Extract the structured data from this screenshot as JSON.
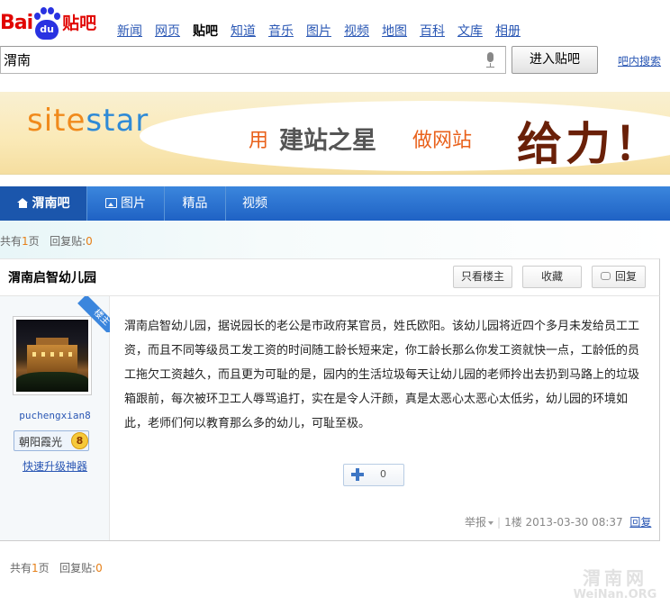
{
  "header": {
    "logo": {
      "bai": "Bai",
      "du": "du",
      "tieba": "贴吧"
    },
    "nav": [
      "新闻",
      "网页",
      "贴吧",
      "知道",
      "音乐",
      "图片",
      "视频",
      "地图",
      "百科",
      "文库",
      "相册"
    ],
    "nav_current": "贴吧"
  },
  "search": {
    "value": "渭南",
    "enter_button": "进入贴吧",
    "inbar_search": "吧内搜索"
  },
  "banner": {
    "brand": "sitestar",
    "brand_a": "site",
    "brand_b": "star",
    "use": "用",
    "product": "建站之星",
    "action": "做网站",
    "slogan": "给力！"
  },
  "tabs": [
    {
      "label": "渭南吧",
      "icon": "home-icon"
    },
    {
      "label": "图片",
      "icon": "picture-icon"
    },
    {
      "label": "精品"
    },
    {
      "label": "视频"
    }
  ],
  "pageinfo": {
    "prefix": "共有",
    "pages": "1",
    "pages_suffix": "页",
    "replies_label": "回复贴:",
    "replies": "0"
  },
  "thread": {
    "title": "渭南启智幼儿园",
    "buttons": {
      "only_op": "只看楼主",
      "favorite": "收藏",
      "reply": "回复"
    }
  },
  "post": {
    "badge": "楼主",
    "username": "puchengxian8",
    "level_name": "朝阳霞光",
    "level": "8",
    "upgrade": "快速升级神器",
    "content": "渭南启智幼儿园，据说园长的老公是市政府某官员，姓氏欧阳。该幼儿园将近四个多月未发给员工工资，而且不同等级员工发工资的时间随工龄长短来定，你工龄长那么你发工资就快一点，工龄低的员工拖欠工资越久，而且更为可耻的是，园内的生活垃圾每天让幼儿园的老师拎出去扔到马路上的垃圾箱跟前，每次被环卫工人辱骂追打，实在是令人汗颜，真是太恶心太恶心太低劣，幼儿园的环境如此，老师们何以教育那么多的幼儿，可耻至极。",
    "like_count": "0",
    "report": "举报",
    "floor": "1楼",
    "time": "2013-03-30 08:37",
    "reply": "回复"
  },
  "watermark": {
    "cn": "渭南网",
    "en": "WeiNan.ORG"
  },
  "colors": {
    "brand_blue": "#2932e1",
    "brand_red": "#e10602",
    "nav_blue": "#1f62c4",
    "link": "#2a57b4",
    "accent_orange": "#e67f17"
  }
}
